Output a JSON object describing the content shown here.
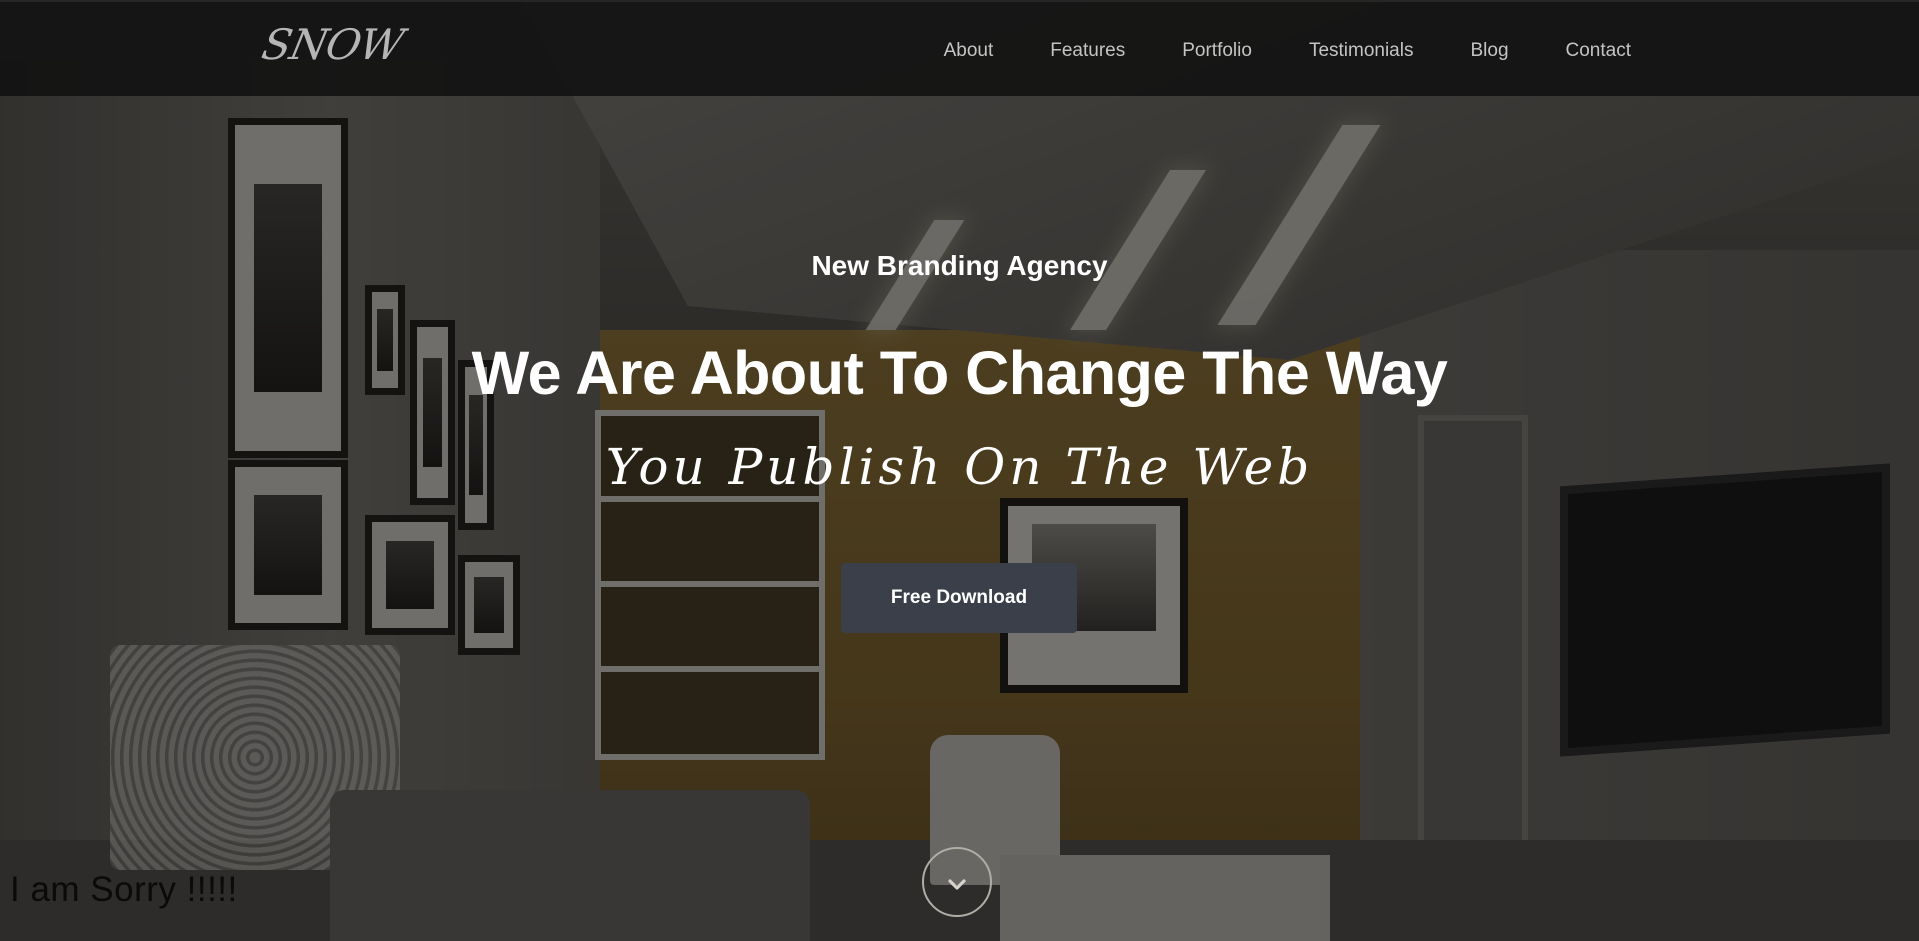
{
  "brand": {
    "logo_text": "SNOW"
  },
  "nav": {
    "items": [
      {
        "label": "About"
      },
      {
        "label": "Features"
      },
      {
        "label": "Portfolio"
      },
      {
        "label": "Testimonials"
      },
      {
        "label": "Blog"
      },
      {
        "label": "Contact"
      }
    ]
  },
  "hero": {
    "subtitle": "New Branding Agency",
    "headline": "We Are About To Change The Way",
    "script_line": "You Publish On The Web",
    "cta_label": "Free Download",
    "scroll_icon": "chevron-down-icon"
  },
  "footer_note": {
    "text": "I am Sorry !!!!!"
  },
  "colors": {
    "cta_bg": "#3b3f49",
    "navbar_bg": "#121212",
    "nav_text": "#c4c4c4"
  }
}
